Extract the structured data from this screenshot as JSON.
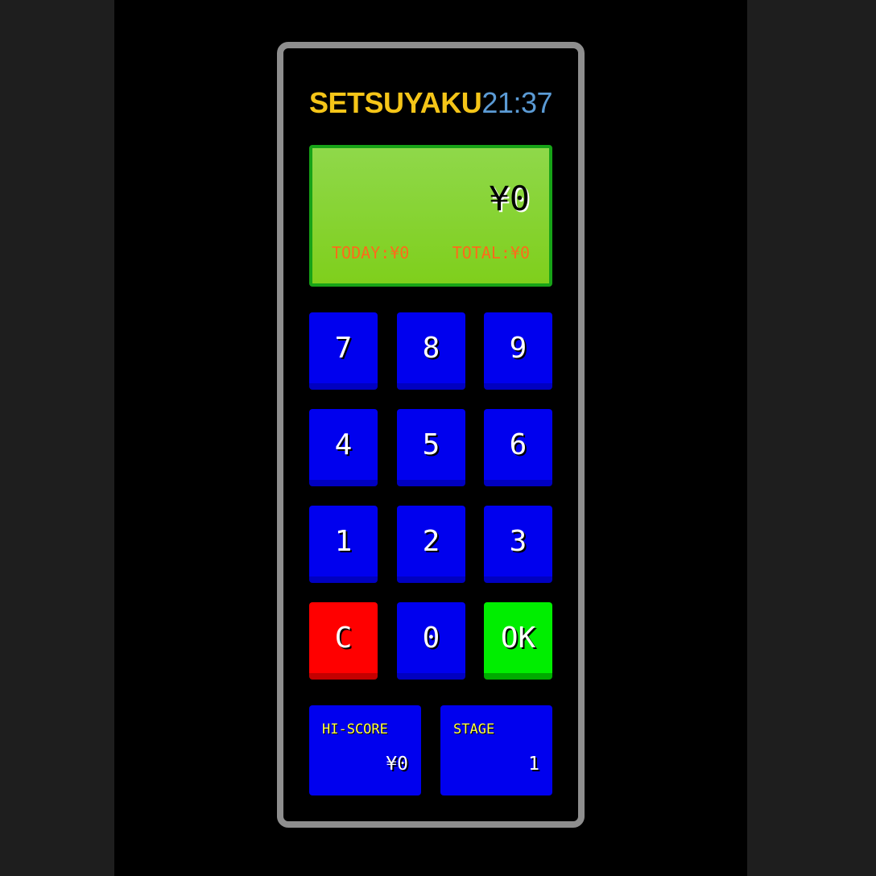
{
  "header": {
    "title": "SETSUYAKU",
    "clock": "21:37"
  },
  "display": {
    "amount": "¥0",
    "today": "TODAY:¥0",
    "total": "TOTAL:¥0"
  },
  "keypad": {
    "keys": [
      "7",
      "8",
      "9",
      "4",
      "5",
      "6",
      "1",
      "2",
      "3",
      "C",
      "0",
      "OK"
    ]
  },
  "stats": {
    "hiscore_label": "HI-SCORE",
    "hiscore_value": "¥0",
    "stage_label": "STAGE",
    "stage_value": "1"
  },
  "colors": {
    "key": "#0000ee",
    "clear_key": "#ff0000",
    "ok_key": "#00ee00",
    "lcd": "#7fcf1c",
    "title": "#f5c518",
    "clock": "#5b9bd5"
  }
}
